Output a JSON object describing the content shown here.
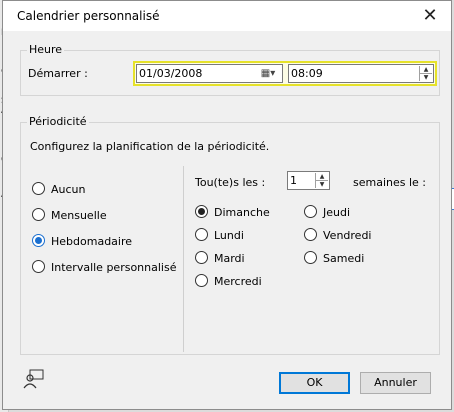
{
  "dialog": {
    "title": "Calendrier personnalisé",
    "close_glyph": "✕"
  },
  "heure": {
    "legend": "Heure",
    "start_label": "Démarrer :",
    "date_value": "01/03/2008",
    "time_value": "08:09"
  },
  "periodicite": {
    "legend": "Périodicité",
    "description": "Configurez la planification de la périodicité.",
    "options": [
      "Aucun",
      "Mensuelle",
      "Hebdomadaire",
      "Intervalle personnalisé"
    ],
    "selected_option": "Hebdomadaire",
    "every_label": "Tou(te)s les :",
    "every_value": "1",
    "weeks_label": "semaines le :",
    "days": [
      "Dimanche",
      "Jeudi",
      "Lundi",
      "Vendredi",
      "Mardi",
      "Samedi",
      "Mercredi"
    ],
    "selected_day": "Dimanche"
  },
  "buttons": {
    "ok": "OK",
    "cancel": "Annuler"
  },
  "icons": {
    "close": "close-icon",
    "calendar": "calendar-dropdown-icon",
    "spin_up": "spin-up-icon",
    "spin_down": "spin-down-icon",
    "user": "user-comment-icon"
  },
  "colors": {
    "highlight_border": "#e6e22a",
    "radio_selected": "#1a6fd0",
    "primary_border": "#0078d7"
  }
}
